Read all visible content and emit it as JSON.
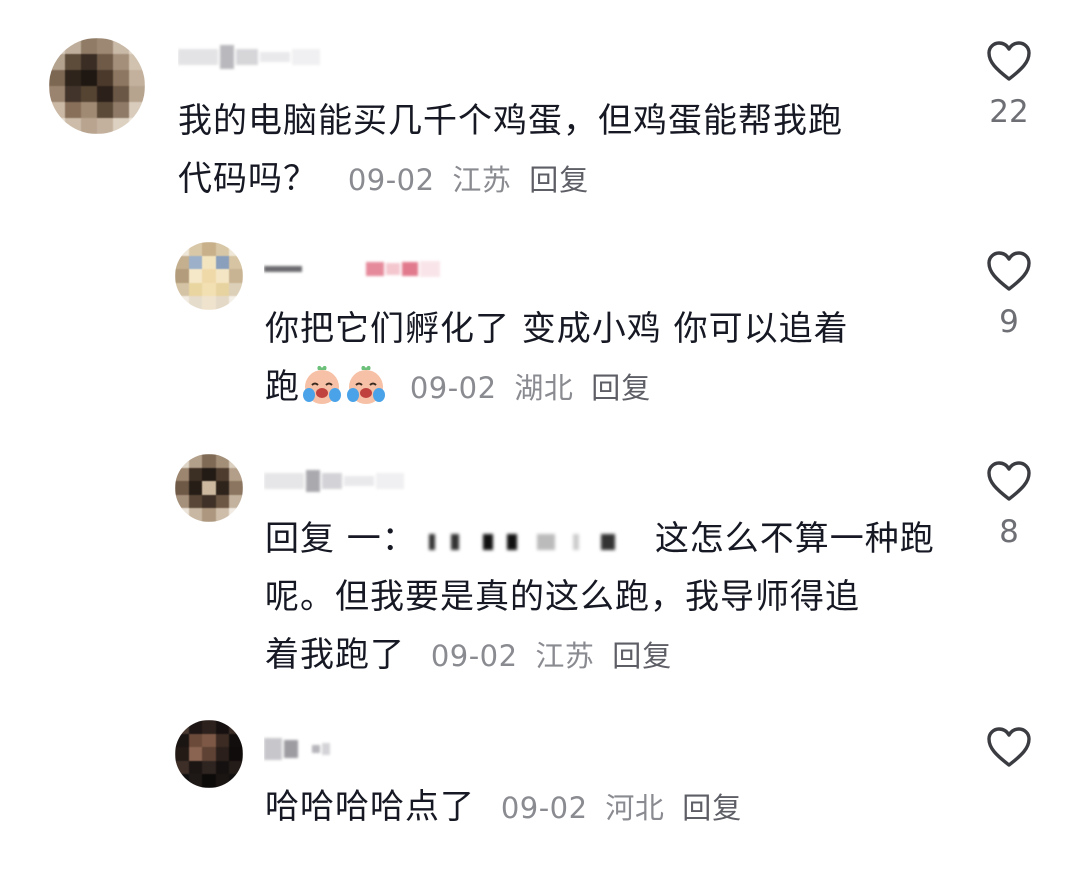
{
  "comments": [
    {
      "text": "我的电脑能买几千个鸡蛋，但鸡蛋能帮我跑代码吗？",
      "line1": "我的电脑能买几千个鸡蛋，但鸡蛋能帮我跑",
      "line2": "代码吗？",
      "date": "09-02",
      "location": "江苏",
      "reply_label": "回复",
      "likes": "22"
    },
    {
      "line1": "你把它们孵化了 变成小鸡 你可以追着",
      "line2": "跑",
      "emojis": [
        "crying-laughing-face-emoji",
        "crying-laughing-face-emoji"
      ],
      "date": "09-02",
      "location": "湖北",
      "reply_label": "回复",
      "likes": "9"
    },
    {
      "line1_prefix": "回复 一：",
      "line1_suffix": "这怎么不算一种跑",
      "line2": "呢。但我要是真的这么跑，我导师得追",
      "line3": "着我跑了",
      "date": "09-02",
      "location": "江苏",
      "reply_label": "回复",
      "likes": "8"
    },
    {
      "line1": "哈哈哈哈点了",
      "date": "09-02",
      "location": "河北",
      "reply_label": "回复",
      "likes": ""
    }
  ],
  "reply_user_initial": "一",
  "colors": {
    "text": "#161823",
    "meta": "#8a8b91",
    "icon": "#3b3c42"
  },
  "icons": {
    "like": "heart-outline-icon"
  }
}
